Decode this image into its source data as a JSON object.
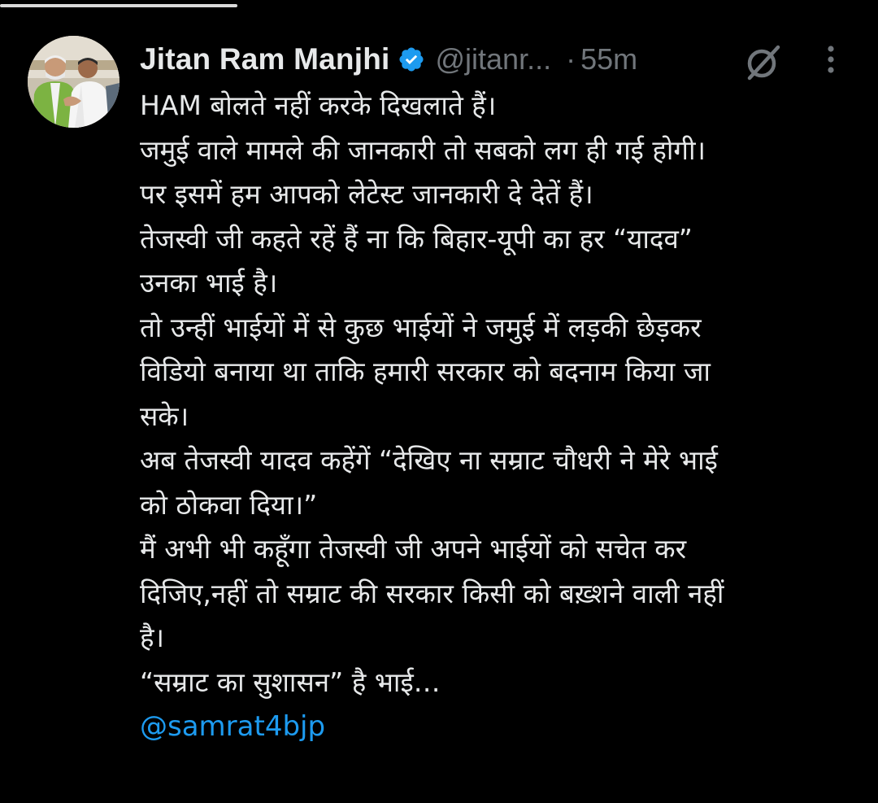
{
  "tweet": {
    "author": {
      "display_name": "Jitan Ram Manjhi",
      "handle": "@jitanr...",
      "verified": true,
      "avatar_icon": "profile-photo"
    },
    "separator": "·",
    "timestamp": "55m",
    "icons": {
      "grok": "grok-icon",
      "more": "more-options-icon"
    },
    "lines": [
      "HAM बोलते नहीं करके दिखलाते हैं।",
      "जमुई वाले मामले की जानकारी तो सबको लग ही गई होगी।",
      "पर इसमें हम आपको लेटेस्ट जानकारी दे देतें हैं।",
      "तेजस्वी जी कहते रहें हैं ना कि बिहार-यूपी का हर “यादव”",
      "उनका भाई है।",
      "तो उन्हीं भाईयों में से कुछ भाईयों ने जमुई में लड़की छेड़कर",
      "विडियो बनाया था ताकि हमारी सरकार को बदनाम किया जा",
      "सके।",
      "अब तेजस्वी यादव कहेंगें “देखिए ना सम्राट चौधरी ने मेरे भाई",
      "को ठोकवा दिया।”",
      "मैं अभी भी कहूँगा तेजस्वी जी अपने भाईयों को सचेत कर",
      "दिजिए,नहीं तो सम्राट की सरकार किसी को बख़्शने वाली नहीं",
      "है।",
      "“सम्राट का सुशासन” है भाई…"
    ],
    "mention": "@samrat4bjp"
  },
  "colors": {
    "background": "#000000",
    "text_primary": "#e7e9ea",
    "text_secondary": "#71767b",
    "link": "#1d9bf0",
    "verified_badge": "#1d9bf0"
  }
}
